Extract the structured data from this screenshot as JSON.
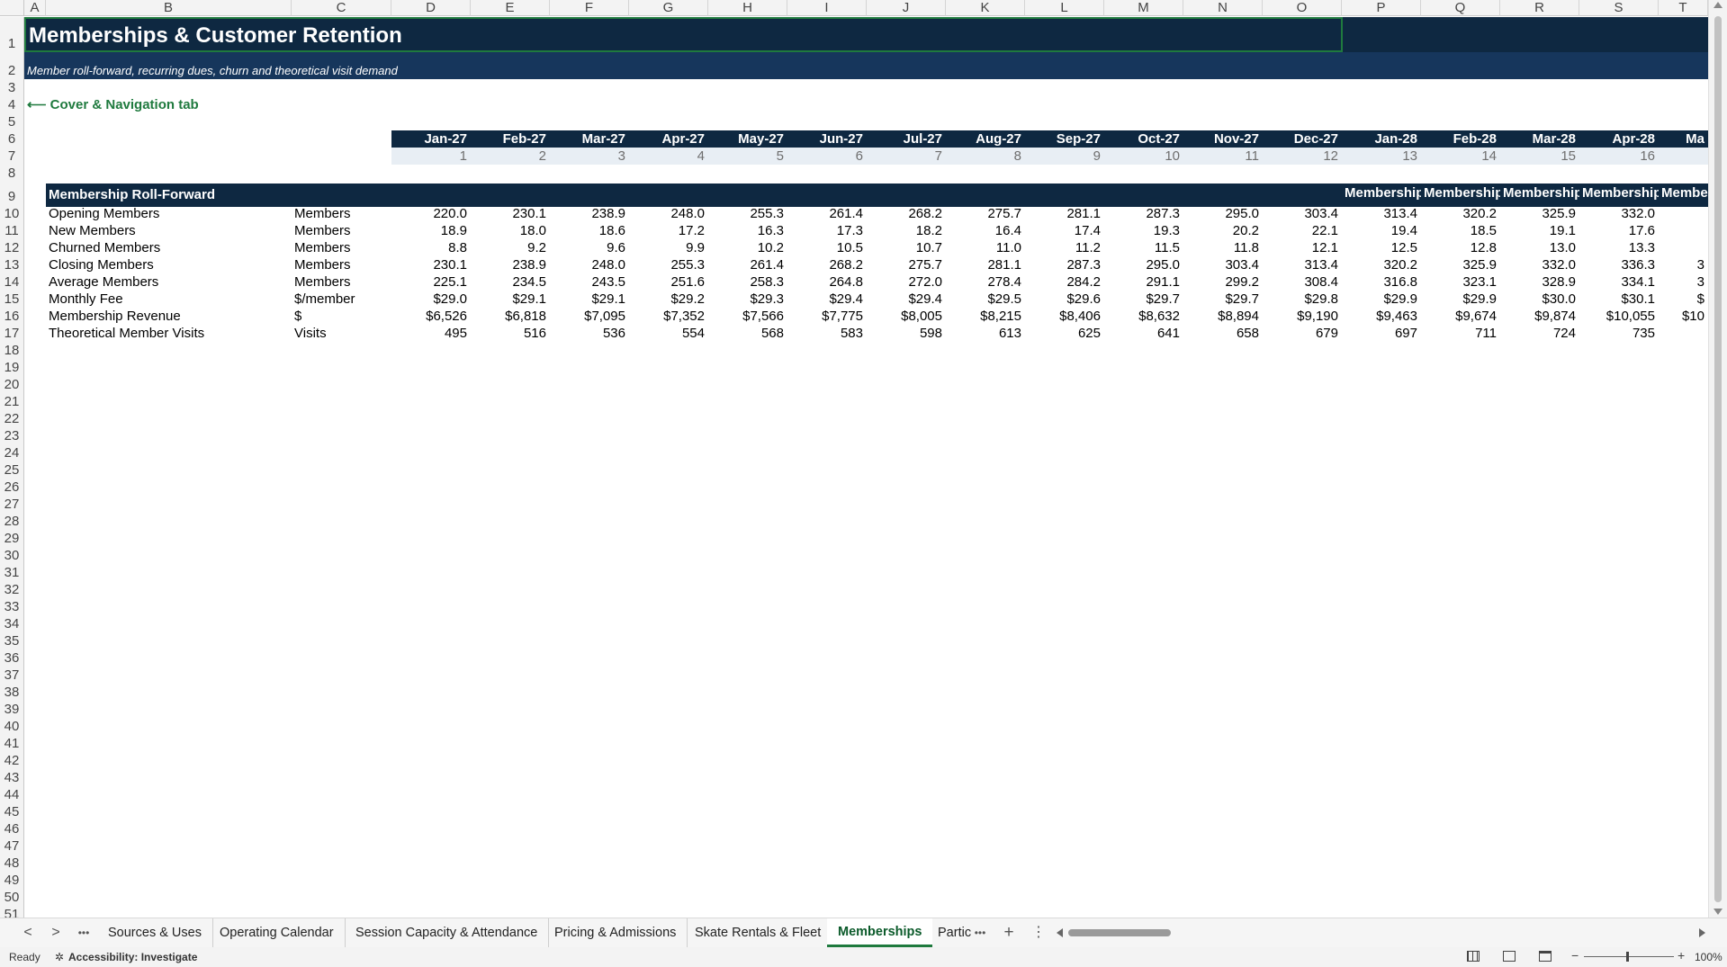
{
  "columns": [
    "A",
    "B",
    "C",
    "D",
    "E",
    "F",
    "G",
    "H",
    "I",
    "J",
    "K",
    "L",
    "M",
    "N",
    "O",
    "P",
    "Q",
    "R",
    "S",
    "T"
  ],
  "rows": [
    "1",
    "2",
    "3",
    "4",
    "5",
    "6",
    "7",
    "8",
    "9",
    "10",
    "11",
    "12",
    "13",
    "14",
    "15",
    "16",
    "17",
    "18",
    "19",
    "20",
    "21",
    "22",
    "23",
    "24",
    "25",
    "26",
    "27",
    "28",
    "29",
    "30",
    "31",
    "32",
    "33",
    "34",
    "35",
    "36",
    "37",
    "38",
    "39",
    "40",
    "41",
    "42",
    "43",
    "44",
    "45",
    "46",
    "47",
    "48",
    "49",
    "50",
    "51"
  ],
  "sheet": {
    "title": "Memberships & Customer Retention",
    "subtitle": "Member roll-forward, recurring dues, churn and theoretical visit demand",
    "nav_link": "⟵ Cover & Navigation tab",
    "months": [
      "Jan-27",
      "Feb-27",
      "Mar-27",
      "Apr-27",
      "May-27",
      "Jun-27",
      "Jul-27",
      "Aug-27",
      "Sep-27",
      "Oct-27",
      "Nov-27",
      "Dec-27",
      "Jan-28",
      "Feb-28",
      "Mar-28",
      "Apr-28",
      "Ma"
    ],
    "period_index": [
      "1",
      "2",
      "3",
      "4",
      "5",
      "6",
      "7",
      "8",
      "9",
      "10",
      "11",
      "12",
      "13",
      "14",
      "15",
      "16"
    ],
    "section_title": "Membership Roll-Forward",
    "section_repeat_labels": [
      "Membership",
      "Membership",
      "Membership",
      "Membership",
      "Membe"
    ],
    "table_rows": [
      {
        "label": "Opening Members",
        "unit": "Members",
        "values": [
          "220.0",
          "230.1",
          "238.9",
          "248.0",
          "255.3",
          "261.4",
          "268.2",
          "275.7",
          "281.1",
          "287.3",
          "295.0",
          "303.4",
          "313.4",
          "320.2",
          "325.9",
          "332.0",
          ""
        ]
      },
      {
        "label": "New Members",
        "unit": "Members",
        "values": [
          "18.9",
          "18.0",
          "18.6",
          "17.2",
          "16.3",
          "17.3",
          "18.2",
          "16.4",
          "17.4",
          "19.3",
          "20.2",
          "22.1",
          "19.4",
          "18.5",
          "19.1",
          "17.6",
          ""
        ]
      },
      {
        "label": "Churned Members",
        "unit": "Members",
        "values": [
          "8.8",
          "9.2",
          "9.6",
          "9.9",
          "10.2",
          "10.5",
          "10.7",
          "11.0",
          "11.2",
          "11.5",
          "11.8",
          "12.1",
          "12.5",
          "12.8",
          "13.0",
          "13.3",
          ""
        ]
      },
      {
        "label": "Closing Members",
        "unit": "Members",
        "values": [
          "230.1",
          "238.9",
          "248.0",
          "255.3",
          "261.4",
          "268.2",
          "275.7",
          "281.1",
          "287.3",
          "295.0",
          "303.4",
          "313.4",
          "320.2",
          "325.9",
          "332.0",
          "336.3",
          "3"
        ]
      },
      {
        "label": "Average Members",
        "unit": "Members",
        "values": [
          "225.1",
          "234.5",
          "243.5",
          "251.6",
          "258.3",
          "264.8",
          "272.0",
          "278.4",
          "284.2",
          "291.1",
          "299.2",
          "308.4",
          "316.8",
          "323.1",
          "328.9",
          "334.1",
          "3"
        ]
      },
      {
        "label": "Monthly Fee",
        "unit": "$/member",
        "values": [
          "$29.0",
          "$29.1",
          "$29.1",
          "$29.2",
          "$29.3",
          "$29.4",
          "$29.4",
          "$29.5",
          "$29.6",
          "$29.7",
          "$29.7",
          "$29.8",
          "$29.9",
          "$29.9",
          "$30.0",
          "$30.1",
          "$"
        ]
      },
      {
        "label": "Membership Revenue",
        "unit": "$",
        "values": [
          "$6,526",
          "$6,818",
          "$7,095",
          "$7,352",
          "$7,566",
          "$7,775",
          "$8,005",
          "$8,215",
          "$8,406",
          "$8,632",
          "$8,894",
          "$9,190",
          "$9,463",
          "$9,674",
          "$9,874",
          "$10,055",
          "$10"
        ]
      },
      {
        "label": "Theoretical Member Visits",
        "unit": "Visits",
        "values": [
          "495",
          "516",
          "536",
          "554",
          "568",
          "583",
          "598",
          "613",
          "625",
          "641",
          "658",
          "679",
          "697",
          "711",
          "724",
          "735",
          ""
        ]
      }
    ]
  },
  "tabs": {
    "items": [
      "Sources & Uses",
      "Operating Calendar",
      "Session Capacity & Attendance",
      "Pricing & Admissions",
      "Skate Rentals & Fleet",
      "Memberships",
      "Partic"
    ],
    "active": "Memberships",
    "prev_icon": "<",
    "next_icon": ">",
    "more_icon": "•••",
    "add_icon": "+",
    "options_icon": "⋮"
  },
  "status": {
    "ready": "Ready",
    "accessibility": "Accessibility: Investigate",
    "zoom": "100%"
  },
  "colors": {
    "title_band": "#0e2841",
    "subtitle_band": "#16365c",
    "header_band": "#0e2841",
    "index_band": "#e8eef4",
    "nav_link": "#1f7a3e",
    "active_tab": "#1f7a3e"
  }
}
